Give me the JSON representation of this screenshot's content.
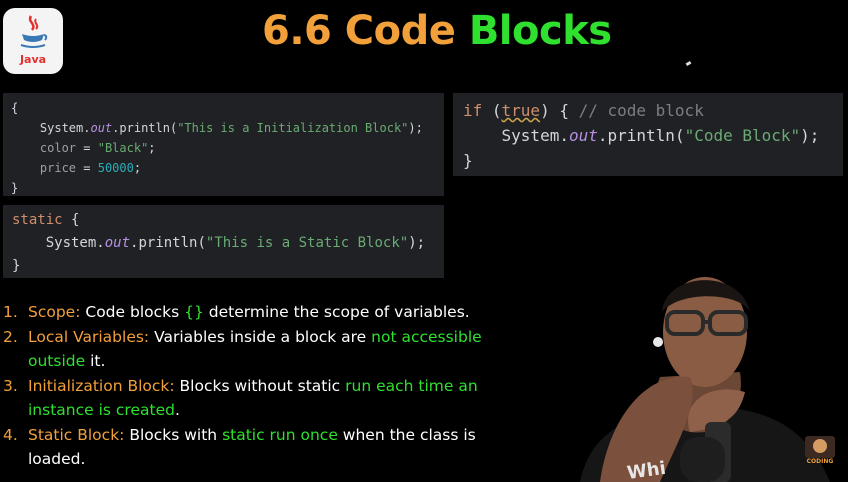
{
  "logo": {
    "label": "Java"
  },
  "title": {
    "prefix": "6.6 Code ",
    "highlight": "Blocks"
  },
  "code_init": {
    "open": "{",
    "line1_a": "System.",
    "line1_out": "out",
    "line1_b": ".println(",
    "line1_str": "\"This is a Initialization Block\"",
    "line1_c": ");",
    "line2_var": "color",
    "line2_eq": " = ",
    "line2_str": "\"Black\"",
    "line2_end": ";",
    "line3_var": "price",
    "line3_eq": " = ",
    "line3_num": "50000",
    "line3_end": ";",
    "close": "}"
  },
  "code_if": {
    "kw_if": "if",
    "paren_open": " (",
    "kw_true": "true",
    "paren_close": ") { ",
    "comment": "// code block",
    "line1_a": "System.",
    "line1_out": "out",
    "line1_b": ".println(",
    "line1_str": "\"Code Block\"",
    "line1_c": ");",
    "close": "}"
  },
  "code_static": {
    "kw_static": "static",
    "brace": " {",
    "line1_a": "System.",
    "line1_out": "out",
    "line1_b": ".println(",
    "line1_str": "\"This is a Static Block\"",
    "line1_c": ");",
    "close": "}"
  },
  "points": [
    {
      "num": "1.",
      "term": "Scope:",
      "t1": " Code blocks ",
      "g1": "{}",
      "t2": " determine the scope of variables."
    },
    {
      "num": "2.",
      "term": "Local Variables:",
      "t1": " Variables inside a block are ",
      "g1": "not accessible outside",
      "t2": " it."
    },
    {
      "num": "3.",
      "term": "Initialization Block:",
      "t1": " Blocks without static ",
      "g1": "run each time an instance is created",
      "t2": "."
    },
    {
      "num": "4.",
      "term": "Static Block:",
      "t1": " Blocks with ",
      "g1": "static run once",
      "t2": " when the class is loaded."
    }
  ],
  "channel": {
    "badge_text": "CODING"
  },
  "colors": {
    "title": "#f2a03a",
    "accent_green": "#2fe02f",
    "code_bg": "#1f2124"
  }
}
